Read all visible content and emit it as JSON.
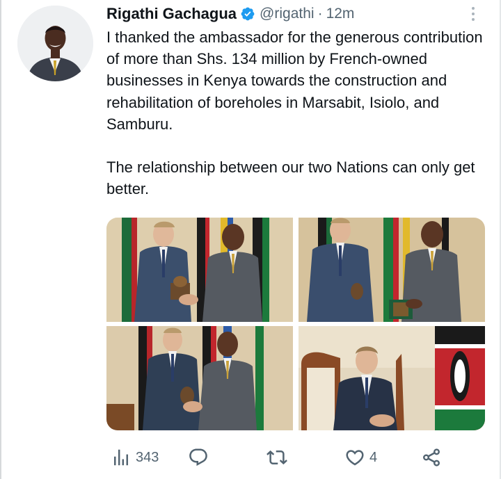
{
  "tweet": {
    "display_name": "Rigathi Gachagua",
    "verified": true,
    "handle": "@rigathi",
    "separator": "·",
    "time": "12m",
    "text": "I thanked the ambassador for the generous contribution of more than Shs. 134 million by French-owned businesses in Kenya towards the construction and rehabilitation of boreholes in Marsabit, Isiolo, and Samburu.\n\nThe relationship between our two Nations can only get better.",
    "photos": [
      {
        "icon": "photo-handshake-gift"
      },
      {
        "icon": "photo-handover-gift"
      },
      {
        "icon": "photo-exchange-gift"
      },
      {
        "icon": "photo-seated-ambassador"
      }
    ]
  },
  "actions": {
    "views_count": "343",
    "replies_count": "",
    "retweets_count": "",
    "likes_count": "4"
  },
  "icons": {
    "verified": "verified-badge-icon",
    "more": "more-options-icon",
    "views": "views-icon",
    "reply": "reply-icon",
    "retweet": "retweet-icon",
    "like": "like-icon",
    "share": "share-icon"
  },
  "colors": {
    "text": "#0f1419",
    "muted": "#536471",
    "verified": "#1d9bf0"
  }
}
